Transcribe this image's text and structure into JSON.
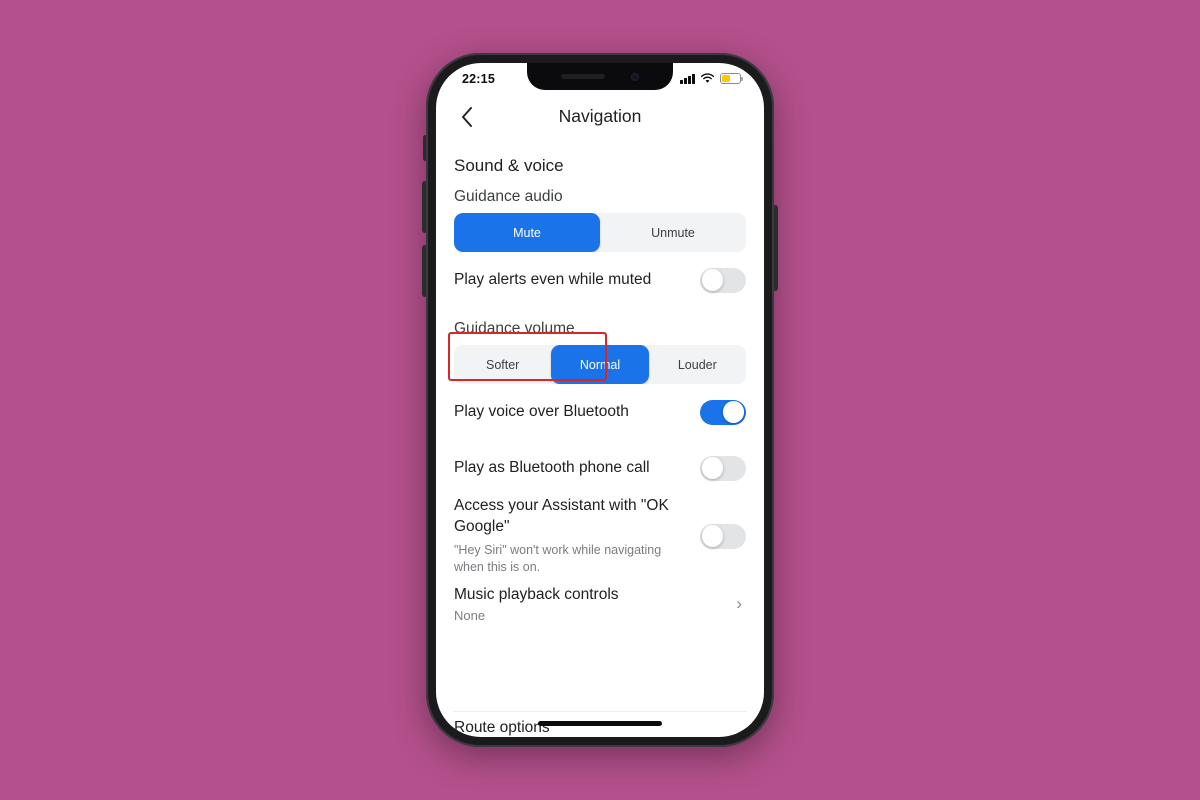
{
  "background_color": "#b4508c",
  "accent_color": "#1a73e8",
  "highlight_color": "#d62828",
  "status_bar": {
    "time": "22:15",
    "cellular_icon": "signal-bars-icon",
    "wifi_icon": "wifi-icon",
    "battery_icon": "battery-icon",
    "battery_color": "#fcc70a"
  },
  "nav_bar": {
    "back_icon": "chevron-left-icon",
    "title": "Navigation"
  },
  "sections": {
    "sound_voice_title": "Sound & voice",
    "guidance_audio": {
      "label": "Guidance audio",
      "options": [
        "Mute",
        "Unmute"
      ],
      "selected": "Mute"
    },
    "play_alerts": {
      "title": "Play alerts even while muted",
      "toggle_state": "off"
    },
    "guidance_volume": {
      "label": "Guidance volume",
      "options": [
        "Softer",
        "Normal",
        "Louder"
      ],
      "selected": "Normal"
    },
    "play_voice_bluetooth": {
      "title": "Play voice over Bluetooth",
      "toggle_state": "on"
    },
    "play_bluetooth_call": {
      "title": "Play as Bluetooth phone call",
      "toggle_state": "off"
    },
    "assistant": {
      "title": "Access your Assistant with \"OK Google\"",
      "subtitle": "\"Hey Siri\" won't work while navigating when this is on.",
      "toggle_state": "off"
    },
    "music_playback": {
      "title": "Music playback controls",
      "value": "None",
      "chevron_icon": "chevron-right-icon"
    },
    "route_options": {
      "title": "Route options"
    }
  }
}
